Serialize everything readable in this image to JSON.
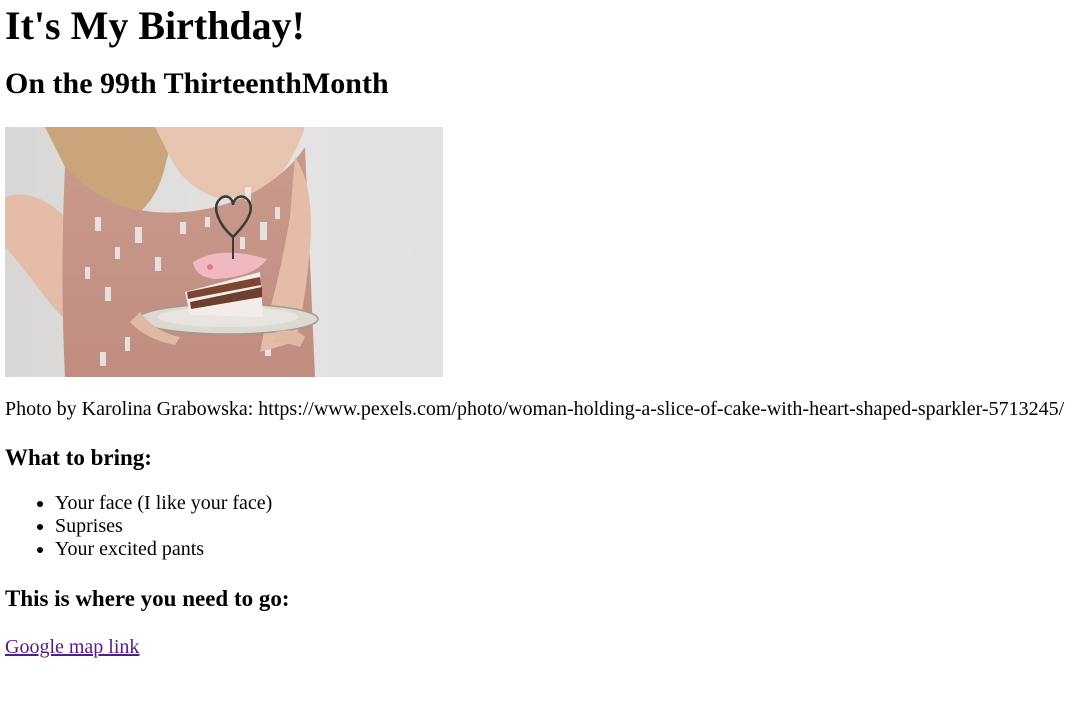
{
  "title": "It's My Birthday!",
  "subtitle": "On the 99th ThirteenthMonth",
  "photo": {
    "alt": "Woman holding a slice of cake with heart shaped sparkler",
    "caption": "Photo by Karolina Grabowska: https://www.pexels.com/photo/woman-holding-a-slice-of-cake-with-heart-shaped-sparkler-5713245/"
  },
  "bring": {
    "heading": "What to bring:",
    "items": [
      "Your face (I like your face)",
      "Suprises",
      "Your excited pants"
    ]
  },
  "location": {
    "heading": "This is where you need to go:",
    "link_label": "Google map link"
  },
  "colors": {
    "visited_link": "#551a8b",
    "text": "#000000",
    "background": "#ffffff"
  }
}
